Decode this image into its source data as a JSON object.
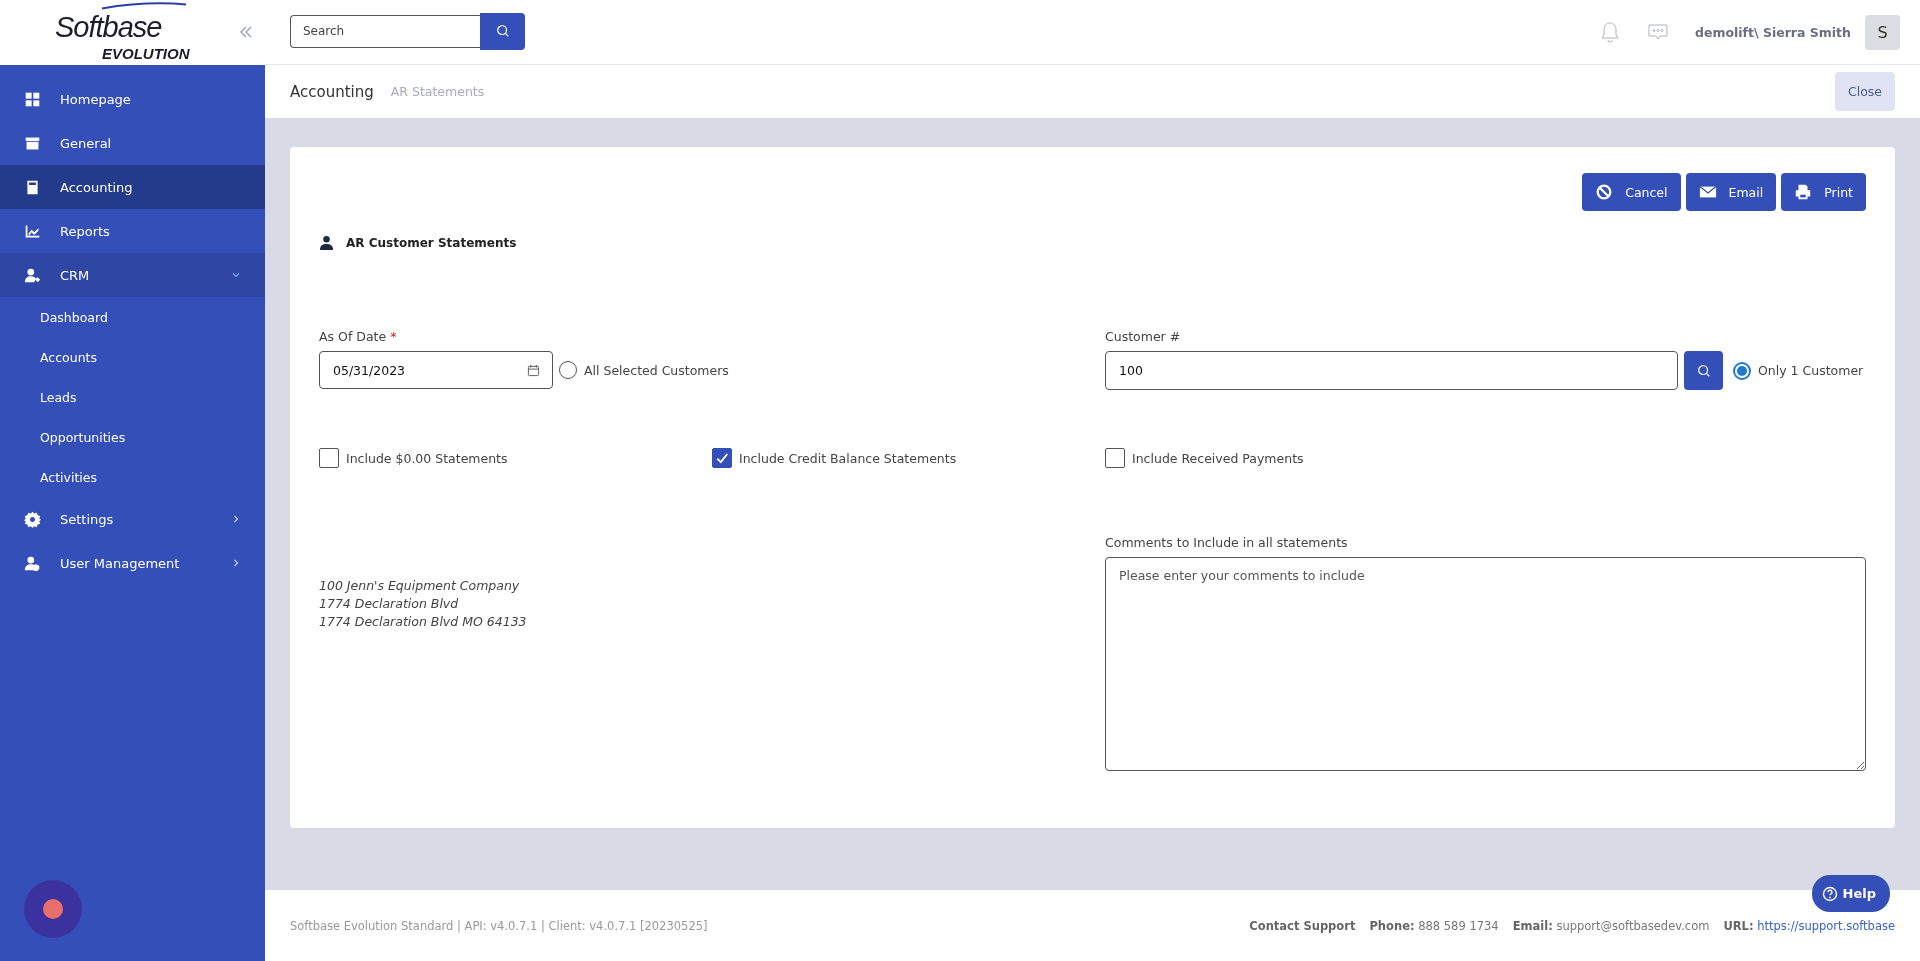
{
  "sidebar": {
    "logo": {
      "line1": "Softbase",
      "line2": "EVOLUTION"
    },
    "items": [
      {
        "label": "Homepage",
        "selected": false
      },
      {
        "label": "General",
        "selected": false
      },
      {
        "label": "Accounting",
        "selected": true
      },
      {
        "label": "Reports",
        "selected": false
      },
      {
        "label": "CRM",
        "selected": false,
        "expanded": true,
        "children": [
          {
            "label": "Dashboard",
            "selected": false
          },
          {
            "label": "Accounts",
            "selected": false
          },
          {
            "label": "Leads",
            "selected": false
          },
          {
            "label": "Opportunities",
            "selected": false
          },
          {
            "label": "Activities",
            "selected": false
          }
        ]
      },
      {
        "label": "Settings",
        "selected": false,
        "expanded": false
      },
      {
        "label": "User Management",
        "selected": false,
        "expanded": false
      }
    ]
  },
  "header": {
    "search": {
      "placeholder": "Search"
    },
    "user": "demolift\\ Sierra Smith",
    "avatar": "S"
  },
  "breadcrumb": {
    "items": [
      "Accounting",
      "AR Statements"
    ],
    "close": "Close"
  },
  "actions": [
    "Cancel",
    "Email",
    "Print"
  ],
  "form": {
    "title": "AR Customer Statements",
    "as_of_date": {
      "label": "As Of Date",
      "required_mark": "*",
      "value": "05/31/2023"
    },
    "customer": {
      "label": "Customer #",
      "value": "100"
    },
    "radios": [
      {
        "label": "All Selected Customers",
        "selected": false
      },
      {
        "label": "Only 1 Customer",
        "selected": true
      }
    ],
    "checkboxes": [
      {
        "label": "Include $0.00 Statements",
        "checked": false
      },
      {
        "label": "Include Credit Balance Statements",
        "checked": true
      },
      {
        "label": "Include Received Payments",
        "checked": false
      }
    ],
    "address": [
      "100 Jenn's Equipment Company",
      "1774 Declaration Blvd",
      "1774 Declaration Blvd MO 64133"
    ],
    "comments": {
      "label": "Comments to Include in all statements",
      "placeholder": "Please enter your comments to include"
    }
  },
  "footer": {
    "version": "Softbase Evolution Standard | API: v4.0.7.1 | Client: v4.0.7.1 [20230525]",
    "contact": "Contact Support",
    "info": [
      {
        "label": "Phone:",
        "value": "888 589 1734"
      },
      {
        "label": "Email:",
        "value": "support@softbasedev.com"
      },
      {
        "label": "URL:",
        "value": "https://support.softbase"
      }
    ],
    "help": "Help"
  }
}
